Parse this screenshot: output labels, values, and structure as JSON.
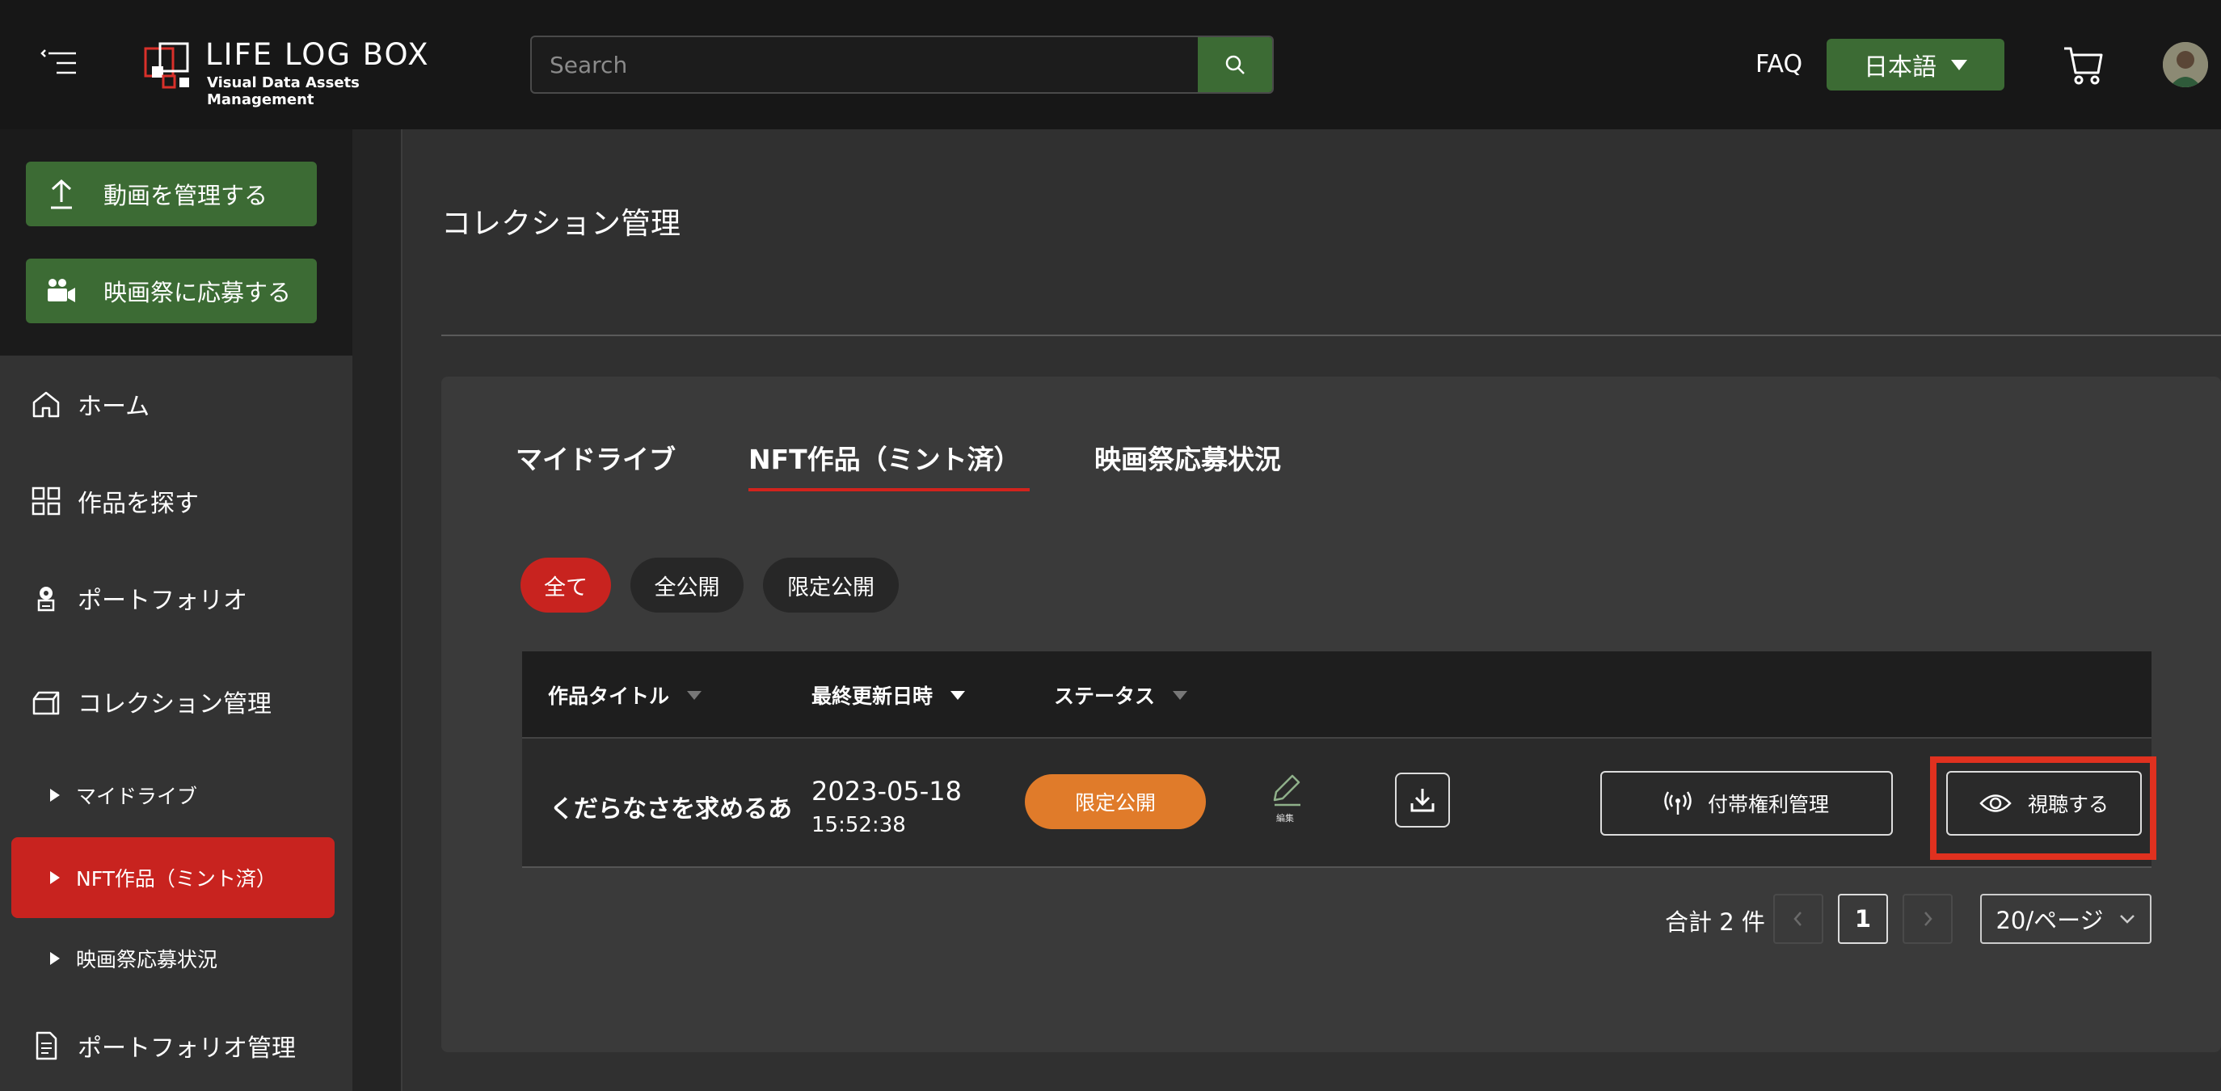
{
  "header": {
    "logo_title": "LIFE LOG BOX",
    "logo_subtitle": "Visual Data Assets Management",
    "search_placeholder": "Search",
    "faq": "FAQ",
    "language": "日本語"
  },
  "sidebar": {
    "actions": [
      {
        "label": "動画を管理する",
        "icon": "upload-icon"
      },
      {
        "label": "映画祭に応募する",
        "icon": "video-camera-icon"
      }
    ],
    "nav": [
      {
        "label": "ホーム",
        "icon": "home-icon"
      },
      {
        "label": "作品を探す",
        "icon": "grid-icon"
      },
      {
        "label": "ポートフォリオ",
        "icon": "badge-icon"
      },
      {
        "label": "コレクション管理",
        "icon": "collection-box-icon"
      }
    ],
    "sub": [
      {
        "label": "マイドライブ"
      },
      {
        "label": "NFT作品（ミント済）",
        "active": true
      },
      {
        "label": "映画祭応募状況"
      }
    ],
    "portfolio_manage": {
      "label": "ポートフォリオ管理",
      "icon": "document-icon"
    }
  },
  "main": {
    "title": "コレクション管理",
    "tabs": [
      {
        "label": "マイドライブ"
      },
      {
        "label": "NFT作品（ミント済）",
        "active": true
      },
      {
        "label": "映画祭応募状況"
      }
    ],
    "filters": [
      {
        "label": "全て",
        "active": true
      },
      {
        "label": "全公開"
      },
      {
        "label": "限定公開"
      }
    ],
    "table": {
      "headers": [
        "作品タイトル",
        "最終更新日時",
        "ステータス"
      ],
      "rows": [
        {
          "title": "くだらなさを求めるあ",
          "date": "2023-05-18",
          "time": "15:52:38",
          "status": "限定公開",
          "edit_caption": "編集",
          "rights_button": "付帯権利管理",
          "view_button": "視聴する"
        }
      ]
    },
    "pagination": {
      "total": "合計 2 件",
      "current_page": "1",
      "per_page": "20/ページ"
    }
  },
  "colors": {
    "accent_green": "#3c6b34",
    "accent_red": "#c8231f",
    "status_orange": "#e07b2a",
    "highlight_red": "#e0311f"
  }
}
